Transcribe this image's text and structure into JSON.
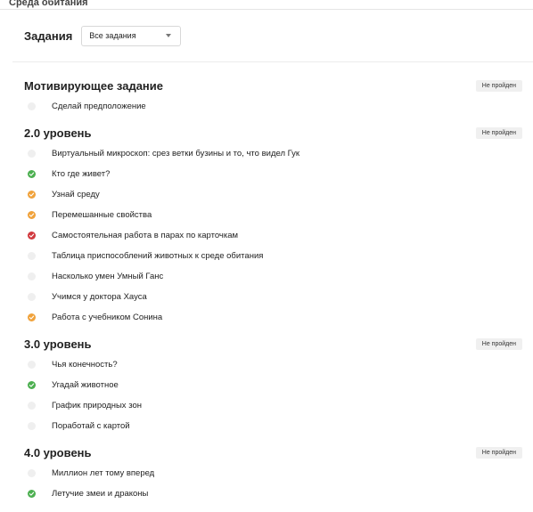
{
  "header": {
    "title_partial": "Среда обитания"
  },
  "filter": {
    "label": "Задания",
    "select_value": "Все задания"
  },
  "status_colors": {
    "done": "#4caf50",
    "partial": "#f0a23b",
    "failed": "#d1393e",
    "none": "#efefef"
  },
  "sections": [
    {
      "title": "Мотивирующее задание",
      "badge": "Не пройден",
      "tasks": [
        {
          "label": "Сделай предположение",
          "status": "none"
        }
      ]
    },
    {
      "title": "2.0 уровень",
      "badge": "Не пройден",
      "tasks": [
        {
          "label": "Виртуальный микроскоп: срез ветки бузины и то, что видел Гук",
          "status": "none"
        },
        {
          "label": "Кто где живет?",
          "status": "green"
        },
        {
          "label": "Узнай среду",
          "status": "orange"
        },
        {
          "label": "Перемешанные свойства",
          "status": "orange"
        },
        {
          "label": "Самостоятельная работа в парах по карточкам",
          "status": "red"
        },
        {
          "label": "Таблица приспособлений животных к среде обитания",
          "status": "none"
        },
        {
          "label": "Насколько умен Умный Ганс",
          "status": "none"
        },
        {
          "label": "Учимся у доктора Хауса",
          "status": "none"
        },
        {
          "label": "Работа с учебником Сонина",
          "status": "orange"
        }
      ]
    },
    {
      "title": "3.0 уровень",
      "badge": "Не пройден",
      "tasks": [
        {
          "label": "Чья конечность?",
          "status": "none"
        },
        {
          "label": "Угадай животное",
          "status": "green"
        },
        {
          "label": "График природных зон",
          "status": "none"
        },
        {
          "label": "Поработай с картой",
          "status": "none"
        }
      ]
    },
    {
      "title": "4.0 уровень",
      "badge": "Не пройден",
      "tasks": [
        {
          "label": "Миллион лет тому вперед",
          "status": "none"
        },
        {
          "label": "Летучие змеи и драконы",
          "status": "green"
        }
      ]
    }
  ]
}
